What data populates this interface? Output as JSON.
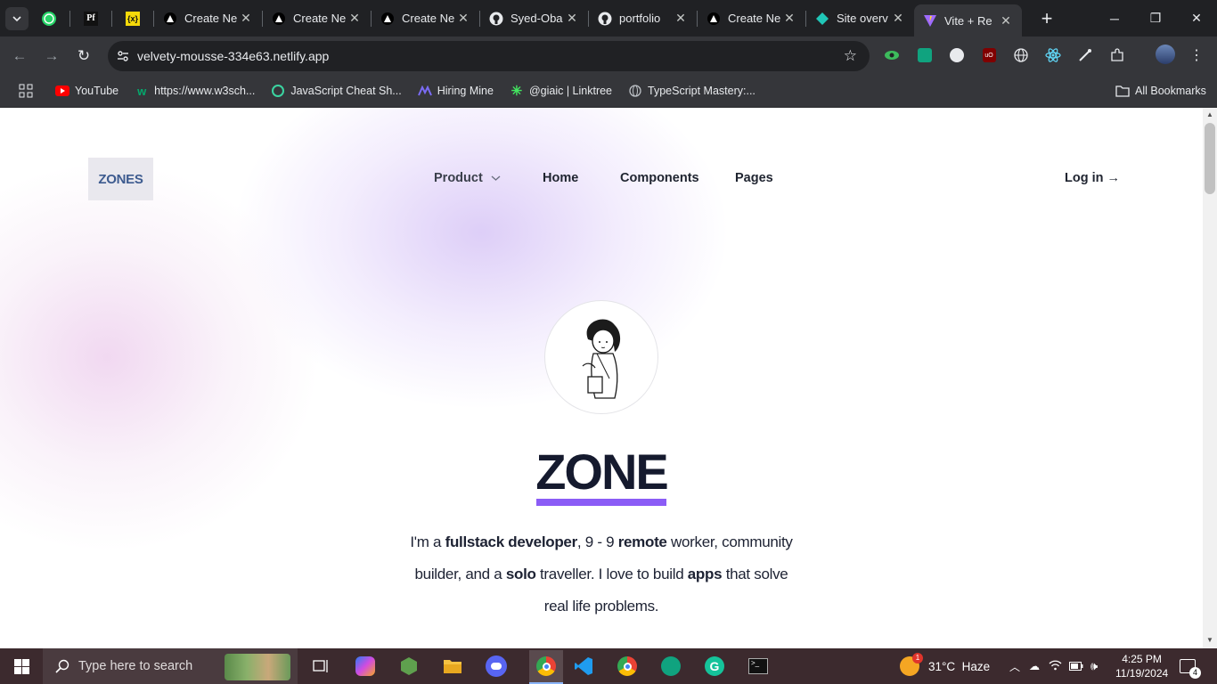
{
  "browser": {
    "tabs": [
      {
        "title": "Create Ne"
      },
      {
        "title": "Create Ne"
      },
      {
        "title": "Create Ne"
      },
      {
        "title": "Syed-Oba"
      },
      {
        "title": "portfolio"
      },
      {
        "title": "Create Ne"
      },
      {
        "title": "Site overv"
      },
      {
        "title": "Vite + Re"
      }
    ],
    "url": "velvety-mousse-334e63.netlify.app",
    "bookmarks": [
      {
        "label": "YouTube"
      },
      {
        "label": "https://www.w3sch..."
      },
      {
        "label": "JavaScript Cheat Sh..."
      },
      {
        "label": "Hiring Mine"
      },
      {
        "label": "@giaic | Linktree"
      },
      {
        "label": "TypeScript Mastery:..."
      }
    ],
    "all_bookmarks": "All Bookmarks"
  },
  "site": {
    "logo": "ZONES",
    "nav": {
      "product": "Product",
      "home": "Home",
      "components": "Components",
      "pages": "Pages",
      "login": "Log in →"
    },
    "hero": {
      "title": "ZONE",
      "intro_parts": {
        "p1": "I'm a ",
        "b1": "fullstack developer",
        "p2": ", 9 - 9 ",
        "b2": "remote",
        "p3": " worker, community builder, and a ",
        "b3": "solo",
        "p4": " traveller. I love to build ",
        "b4": "apps",
        "p5": " that solve real life problems."
      }
    }
  },
  "taskbar": {
    "search_placeholder": "Type here to search",
    "weather": "31°C  Haze",
    "weather_badge": "1",
    "time": "4:25 PM",
    "date": "11/19/2024",
    "notifications": "4"
  },
  "colors": {
    "accent": "#8b5cf6",
    "logo_text": "#3d5b8f",
    "title": "#151a2e"
  }
}
